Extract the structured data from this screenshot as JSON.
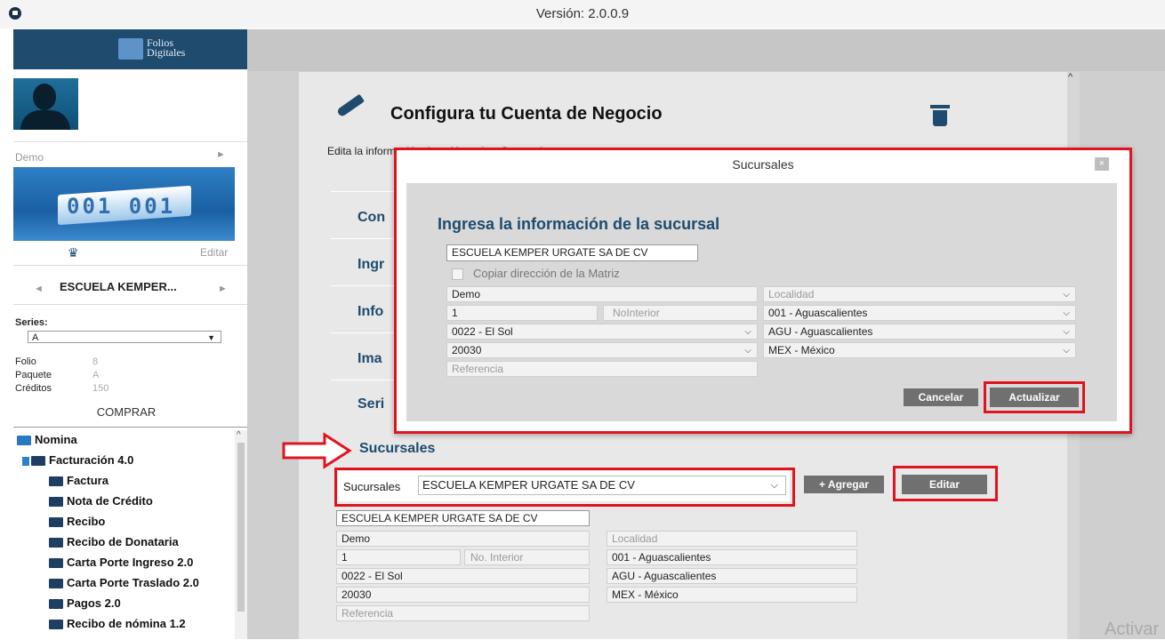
{
  "app": {
    "version": "Versión: 2.0.0.9",
    "brand": "Folios Digitales"
  },
  "sidebar": {
    "account_name": "Demo",
    "logo_digits": "001 001",
    "edit_label": "Editar",
    "company": "ESCUELA KEMPER...",
    "series_label": "Series:",
    "series_value": "A",
    "folio_label": "Folio",
    "folio_value": "8",
    "paquete_label": "Paquete",
    "paquete_value": "A",
    "creditos_label": "Créditos",
    "creditos_value": "150",
    "buy_label": "COMPRAR",
    "tree": [
      "Nomina",
      "Facturación 4.0",
      "Factura",
      "Nota de Crédito",
      "Recibo",
      "Recibo de Donataria",
      "Carta Porte Ingreso 2.0",
      "Carta Porte Traslado 2.0",
      "Pagos 2.0",
      "Recibo de nómina 1.2"
    ]
  },
  "page": {
    "title": "Configura tu Cuenta de Negocio",
    "description": "Edita la información de tu Negocio y Sucursales",
    "sections": [
      "Con",
      "Ingr",
      "Info",
      "Ima",
      "Seri"
    ],
    "sucursales_heading": "Sucursales"
  },
  "modal": {
    "title": "Sucursales",
    "close": "×",
    "heading": "Ingresa la información de la sucursal",
    "name": "ESCUELA KEMPER URGATE SA DE CV",
    "copy_label": "Copiar dirección de la Matriz",
    "street": "Demo",
    "ext_number": "1",
    "int_placeholder": "NoInterior",
    "colonia": "0022 - El Sol",
    "zip": "20030",
    "reference_placeholder": "Referencia",
    "localidad_placeholder": "Localidad",
    "municipio": "001 - Aguascalientes",
    "estado": "AGU - Aguascalientes",
    "pais": "MEX - México",
    "cancel": "Cancelar",
    "update": "Actualizar"
  },
  "branch": {
    "label": "Sucursales",
    "selected": "ESCUELA KEMPER URGATE SA DE CV",
    "add": "+ Agregar",
    "edit": "Editar",
    "name": "ESCUELA KEMPER URGATE SA DE CV",
    "street": "Demo",
    "ext_number": "1",
    "int_placeholder": "No. Interior",
    "colonia": "0022 - El Sol",
    "zip": "20030",
    "reference_placeholder": "Referencia",
    "localidad_placeholder": "Localidad",
    "municipio": "001 - Aguascalientes",
    "estado": "AGU - Aguascalientes",
    "pais": "MEX - México"
  },
  "watermark": "Activar",
  "colors": {
    "accent": "#1e4b6e",
    "highlight": "#e0141e"
  }
}
